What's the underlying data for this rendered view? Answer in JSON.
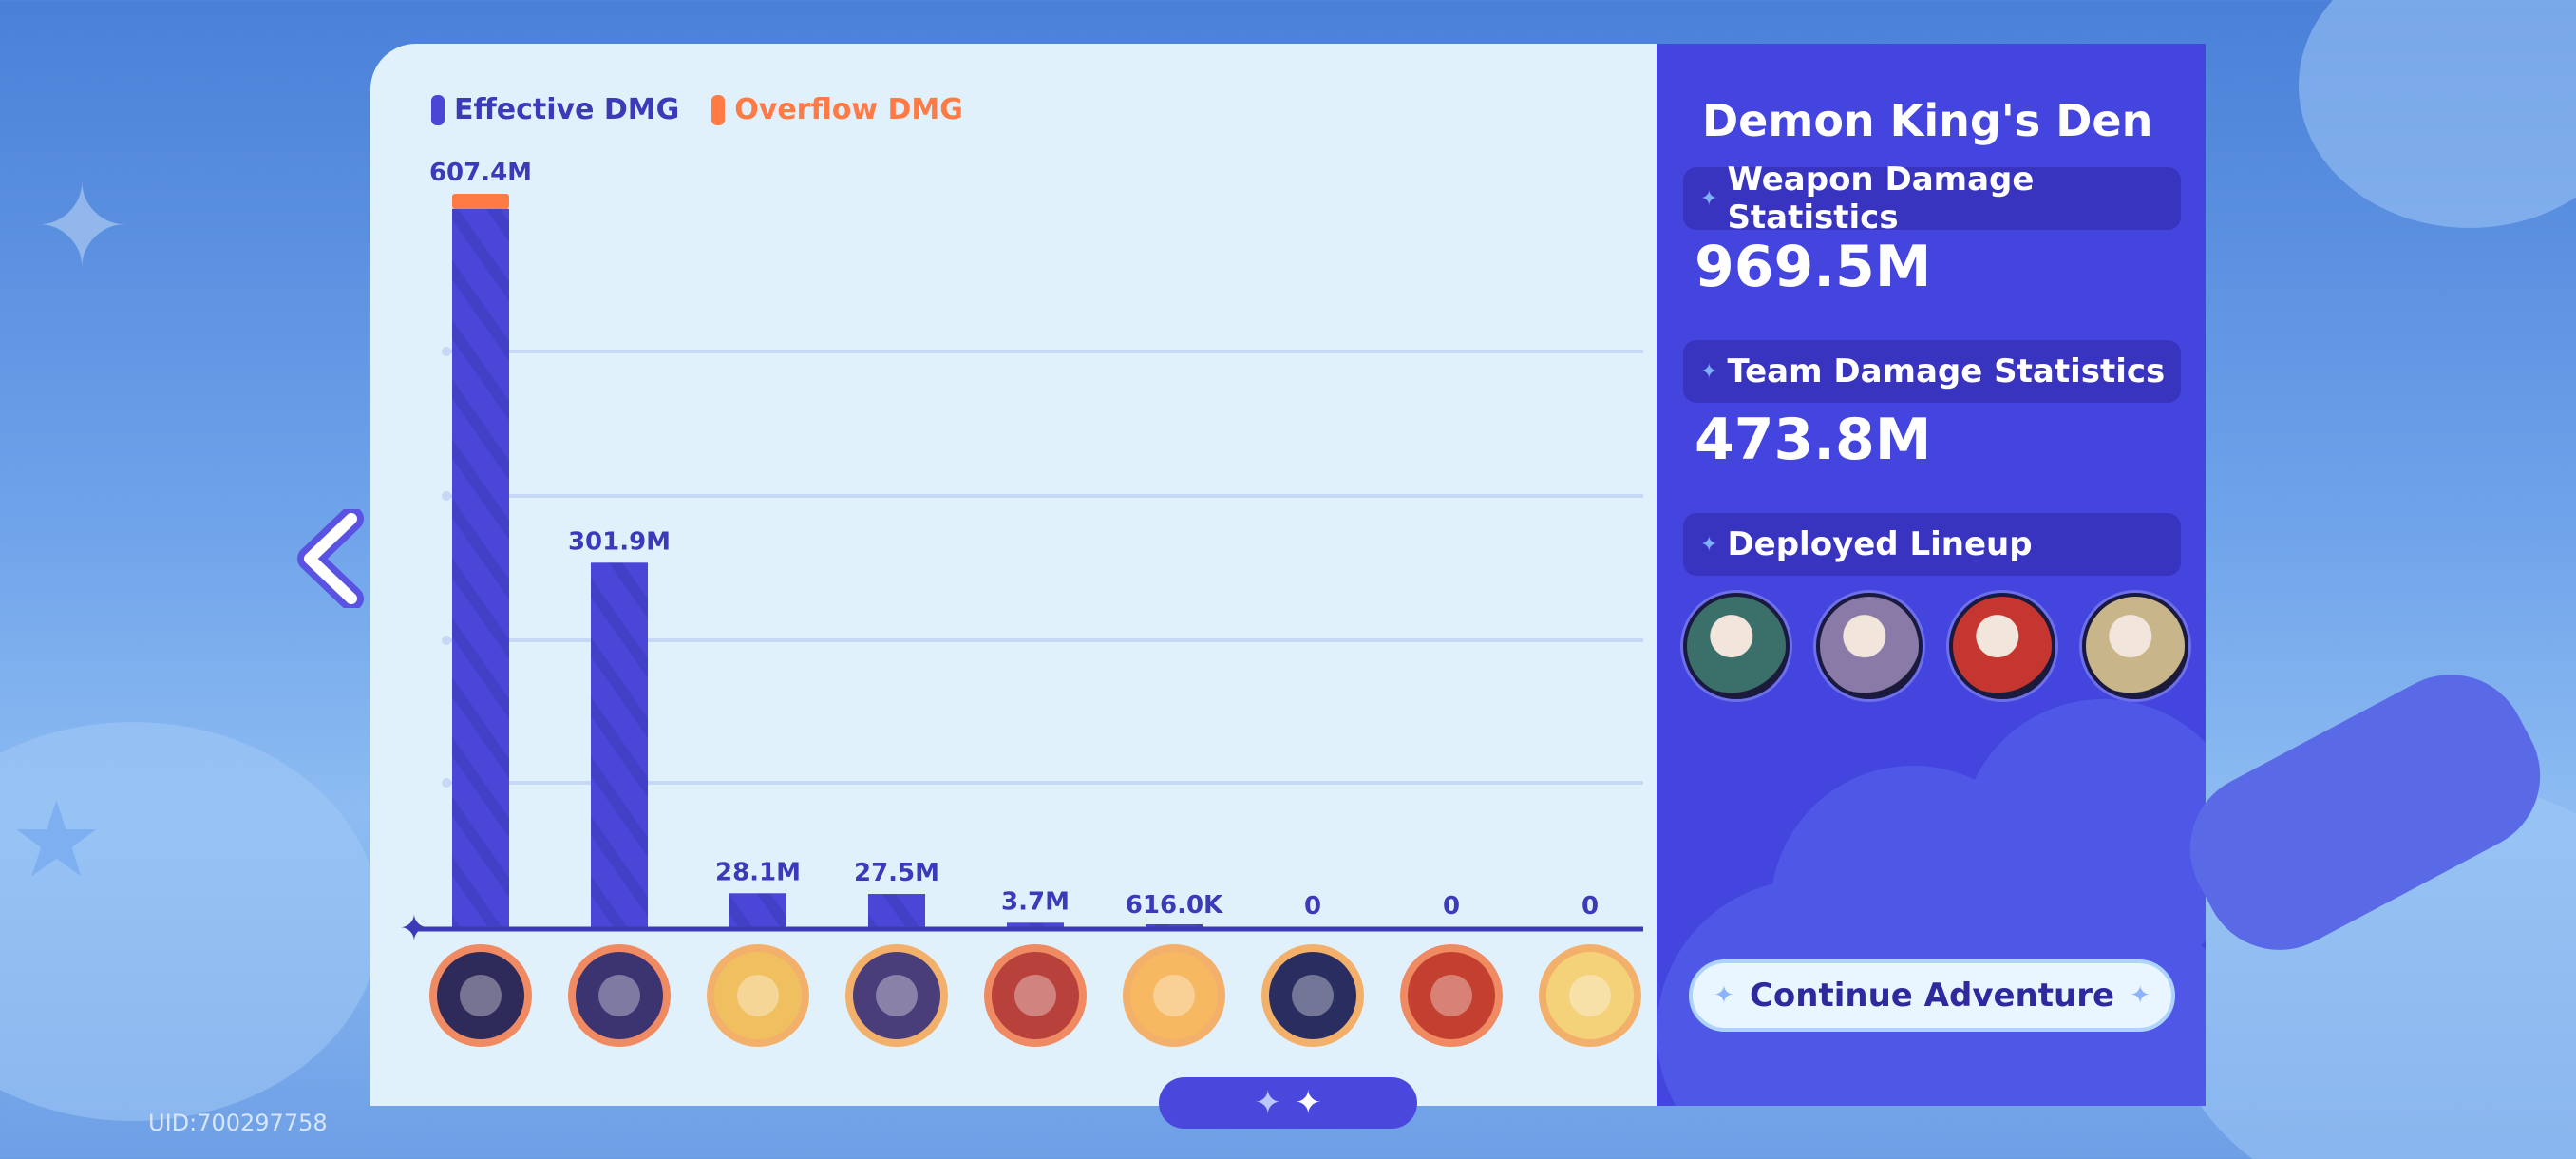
{
  "legend": {
    "effective_label": "Effective DMG",
    "overflow_label": "Overflow DMG",
    "effective_color": "#4b46d8",
    "overflow_color": "#ff7a45"
  },
  "chart_data": {
    "type": "bar",
    "categories": [
      "weapon-1",
      "weapon-2",
      "weapon-3",
      "weapon-4",
      "weapon-5",
      "weapon-6",
      "weapon-7",
      "weapon-8",
      "weapon-9"
    ],
    "value_labels": [
      "607.4M",
      "301.9M",
      "28.1M",
      "27.5M",
      "3.7M",
      "616.0K",
      "0",
      "0",
      "0"
    ],
    "series": [
      {
        "name": "Effective DMG",
        "values": [
          595.0,
          301.9,
          28.1,
          27.5,
          3.7,
          0.616,
          0,
          0,
          0
        ]
      },
      {
        "name": "Overflow DMG",
        "values": [
          12.4,
          0,
          0,
          0,
          0,
          0,
          0,
          0,
          0
        ]
      }
    ],
    "ylim": [
      0,
      607.4
    ],
    "grid": true,
    "legend": "top-left",
    "icons": [
      "demon-hat-icon",
      "dragon-claw-icon",
      "fire-orb-icon",
      "battle-axe-icon",
      "demon-mask-icon",
      "flame-blade-icon",
      "blue-spirit-icon",
      "golden-crown-icon",
      "candle-icon"
    ]
  },
  "summary": {
    "title": "Demon King's Den",
    "weapon_header": "Weapon Damage Statistics",
    "weapon_value": "969.5M",
    "team_header": "Team Damage Statistics",
    "team_value": "473.8M",
    "lineup_header": "Deployed Lineup",
    "lineup": [
      {
        "icon": "character-1-icon",
        "color": "#3b6f6a"
      },
      {
        "icon": "character-2-icon",
        "color": "#8a7aa8"
      },
      {
        "icon": "character-3-icon",
        "color": "#c4362f"
      },
      {
        "icon": "character-4-icon",
        "color": "#c8b68a"
      }
    ]
  },
  "continue_label": "Continue Adventure",
  "uid": "UID:700297758"
}
